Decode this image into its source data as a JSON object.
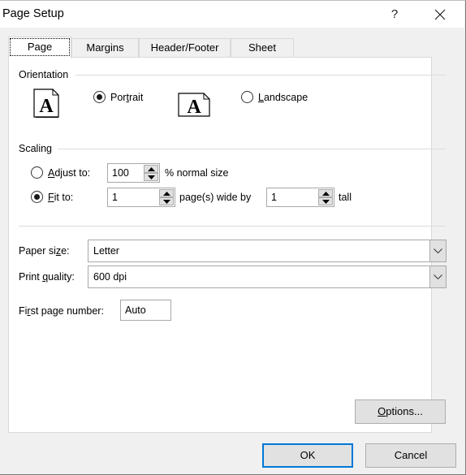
{
  "window": {
    "title": "Page Setup",
    "help_label": "?",
    "close_icon": "close-icon"
  },
  "tabs": [
    {
      "label": "Page",
      "active": true
    },
    {
      "label": "Margins",
      "active": false
    },
    {
      "label": "Header/Footer",
      "active": false
    },
    {
      "label": "Sheet",
      "active": false
    }
  ],
  "orientation": {
    "group_label": "Orientation",
    "portrait": {
      "label_pre": "Por",
      "label_ul": "t",
      "label_post": "rait",
      "checked": true,
      "icon": "portrait-page-icon"
    },
    "landscape": {
      "label_pre": "",
      "label_ul": "L",
      "label_post": "andscape",
      "checked": false,
      "icon": "landscape-page-icon"
    }
  },
  "scaling": {
    "group_label": "Scaling",
    "adjust_to": {
      "label_ul": "A",
      "label_post": "djust to:",
      "value": "100",
      "suffix": "% normal size",
      "checked": false
    },
    "fit_to": {
      "label_ul": "F",
      "label_post": "it to:",
      "checked": true,
      "wide_value": "1",
      "wide_suffix": "page(s) wide by",
      "tall_value": "1",
      "tall_suffix": "tall"
    }
  },
  "paper_size": {
    "label_pre": "Paper si",
    "label_ul": "z",
    "label_post": "e:",
    "value": "Letter"
  },
  "print_quality": {
    "label_pre": "Print ",
    "label_ul": "q",
    "label_post": "uality:",
    "value": "600 dpi"
  },
  "first_page_number": {
    "label_pre": "Fi",
    "label_ul": "r",
    "label_post": "st page number:",
    "value": "Auto"
  },
  "buttons": {
    "options": {
      "label_ul": "O",
      "label_post": "ptions..."
    },
    "ok": "OK",
    "cancel": "Cancel"
  },
  "colors": {
    "accent": "#0078d7",
    "panel_bg": "#ffffff",
    "dialog_bg": "#f0f0f0"
  }
}
